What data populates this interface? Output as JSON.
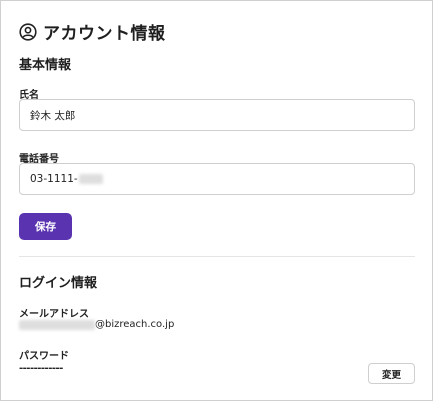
{
  "header": {
    "title": "アカウント情報",
    "icon": "account-circle-icon"
  },
  "basic_info": {
    "section_title": "基本情報",
    "name": {
      "label": "氏名",
      "value": "鈴木 太郎"
    },
    "phone": {
      "label": "電話番号",
      "value_visible": "03-1111-"
    },
    "save_label": "保存"
  },
  "login_info": {
    "section_title": "ログイン情報",
    "email": {
      "label": "メールアドレス",
      "domain": "@bizreach.co.jp"
    },
    "password": {
      "label": "パスワード",
      "masked": "------------"
    },
    "change_label": "変更"
  },
  "colors": {
    "primary": "#5a34b0",
    "border": "#cfcfcf",
    "text": "#222222"
  }
}
